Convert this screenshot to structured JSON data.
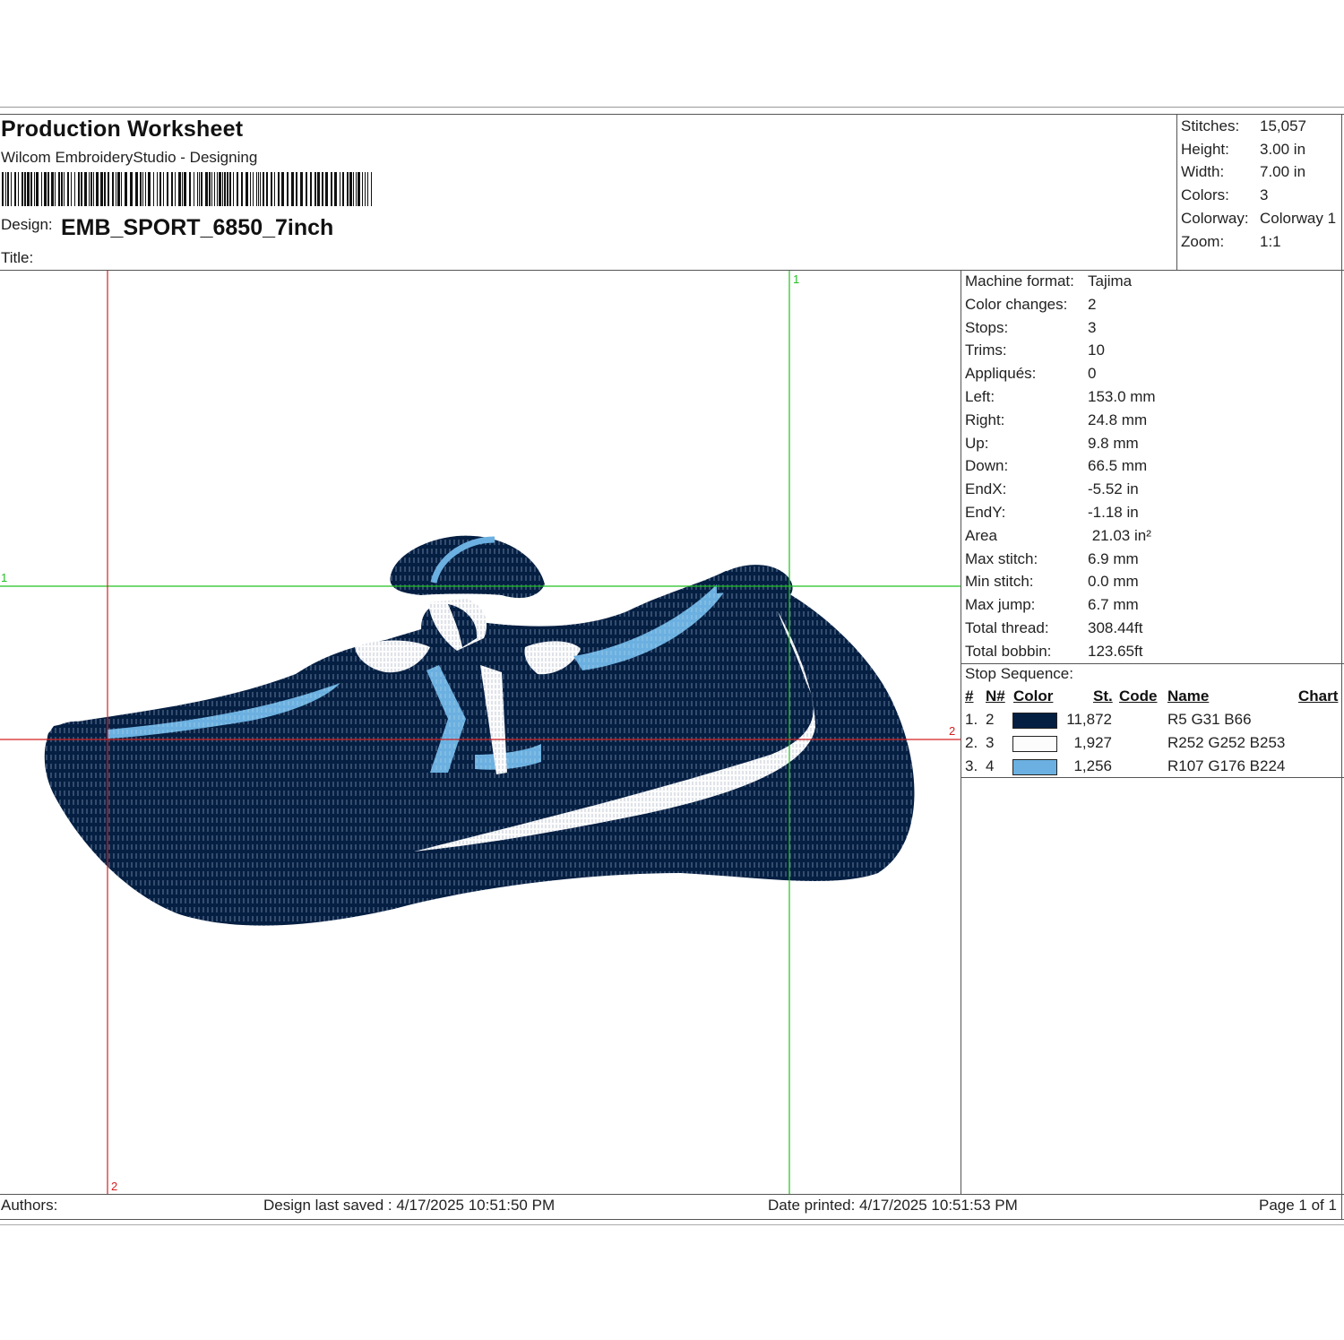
{
  "header": {
    "title": "Production Worksheet",
    "software": "Wilcom EmbroideryStudio - Designing",
    "design_label": "Design:",
    "design_name": "EMB_SPORT_6850_7inch",
    "title_label": "Title:"
  },
  "summary": [
    {
      "label": "Stitches:",
      "value": "15,057"
    },
    {
      "label": "Height:",
      "value": "3.00 in"
    },
    {
      "label": "Width:",
      "value": "7.00 in"
    },
    {
      "label": "Colors:",
      "value": "3"
    },
    {
      "label": "Colorway:",
      "value": "Colorway 1"
    },
    {
      "label": "Zoom:",
      "value": "1:1"
    }
  ],
  "details": [
    {
      "label": "Machine format:",
      "value": "Tajima"
    },
    {
      "label": "Color changes:",
      "value": "2"
    },
    {
      "label": "Stops:",
      "value": "3"
    },
    {
      "label": "Trims:",
      "value": "10"
    },
    {
      "label": "Appliqués:",
      "value": "0"
    },
    {
      "label": "Left:",
      "value": "153.0 mm"
    },
    {
      "label": "Right:",
      "value": "24.8 mm"
    },
    {
      "label": "Up:",
      "value": "9.8 mm"
    },
    {
      "label": "Down:",
      "value": "66.5 mm"
    },
    {
      "label": "EndX:",
      "value": "-5.52 in"
    },
    {
      "label": "EndY:",
      "value": "-1.18 in"
    },
    {
      "label": "Area",
      "value": " 21.03 in²"
    },
    {
      "label": "Max stitch:",
      "value": "6.9 mm"
    },
    {
      "label": "Min stitch:",
      "value": "0.0 mm"
    },
    {
      "label": "Max jump:",
      "value": "6.7 mm"
    },
    {
      "label": "Total thread:",
      "value": "308.44ft"
    },
    {
      "label": "Total bobbin:",
      "value": "123.65ft"
    }
  ],
  "stop_sequence": {
    "title": "Stop Sequence:",
    "headers": {
      "num": "#",
      "needle": "N#",
      "color": "Color",
      "st": "St.",
      "code": "Code",
      "name": "Name",
      "chart": "Chart"
    },
    "rows": [
      {
        "num": "1.",
        "needle": "2",
        "color": "#051f42",
        "stitches": "11,872",
        "name": "R5 G31 B66"
      },
      {
        "num": "2.",
        "needle": "3",
        "color": "#fcfcfd",
        "stitches": "1,927",
        "name": "R252 G252 B253"
      },
      {
        "num": "3.",
        "needle": "4",
        "color": "#6bb0e0",
        "stitches": "1,256",
        "name": "R107 G176 B224"
      }
    ]
  },
  "canvas": {
    "markers": {
      "green_top": "1",
      "green_left": "1",
      "red_right": "2",
      "red_bottom": "2"
    },
    "colors": {
      "dark": "#051f42",
      "white": "#fcfcfd",
      "light_blue": "#6bb0e0",
      "green_guide": "#22c122",
      "red_guide": "#d42020"
    }
  },
  "footer": {
    "authors": "Authors:",
    "saved": "Design last saved : 4/17/2025 10:51:50 PM",
    "printed": "Date printed: 4/17/2025 10:51:53 PM",
    "page": "Page 1 of 1"
  }
}
